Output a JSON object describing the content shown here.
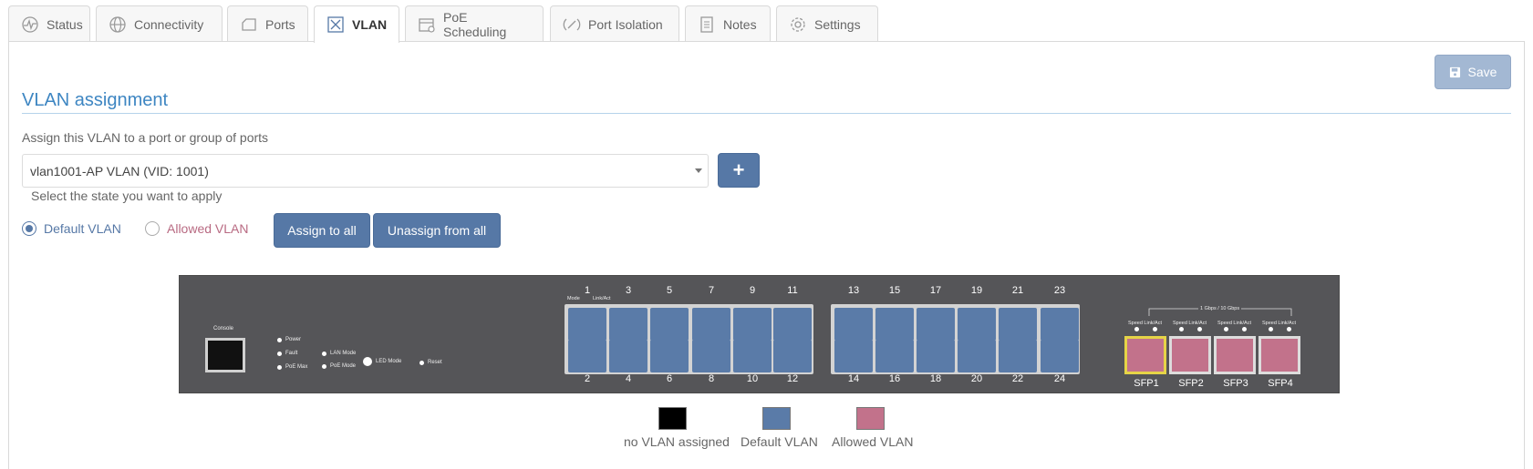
{
  "tabs": [
    {
      "label": "Status",
      "icon": "pulse-icon"
    },
    {
      "label": "Connectivity",
      "icon": "globe-icon"
    },
    {
      "label": "Ports",
      "icon": "ports-icon"
    },
    {
      "label": "VLAN",
      "icon": "vlan-icon",
      "active": true
    },
    {
      "label": "PoE Scheduling",
      "icon": "calendar-icon"
    },
    {
      "label": "Port Isolation",
      "icon": "isolation-icon"
    },
    {
      "label": "Notes",
      "icon": "notes-icon"
    },
    {
      "label": "Settings",
      "icon": "gear-icon"
    }
  ],
  "toolbar": {
    "save_label": "Save"
  },
  "section": {
    "title": "VLAN assignment",
    "assign_label": "Assign this VLAN to a port or group of ports",
    "selected_vlan": "vlan1001-AP VLAN (VID: 1001)",
    "add_label": "+",
    "state_label": "Select the state you want to apply",
    "radio_default": "Default VLAN",
    "radio_allowed": "Allowed VLAN",
    "assign_all": "Assign to all",
    "unassign_all": "Unassign from all"
  },
  "switch": {
    "console": "Console",
    "leds": {
      "power": "Power",
      "fault": "Fault",
      "poe_max": "PoE Max",
      "lan_mode": "LAN Mode",
      "poe_mode": "PoE Mode",
      "led_mode": "LED Mode",
      "reset": "Reset"
    },
    "mode_label": "Mode",
    "link_act_label": "Link/Act",
    "sfp_header": "1 Gbps / 10 Gbps",
    "sfp_speed_label": "Speed Link/Act",
    "top_ports": [
      "1",
      "3",
      "5",
      "7",
      "9",
      "11",
      "13",
      "15",
      "17",
      "19",
      "21",
      "23"
    ],
    "bottom_ports": [
      "2",
      "4",
      "6",
      "8",
      "10",
      "12",
      "14",
      "16",
      "18",
      "20",
      "22",
      "24"
    ],
    "sfp_ports": [
      "SFP1",
      "SFP2",
      "SFP3",
      "SFP4"
    ]
  },
  "legend": [
    {
      "label": "no VLAN assigned",
      "color": "#000000"
    },
    {
      "label": "Default VLAN",
      "color": "#5a7ba8"
    },
    {
      "label": "Allowed VLAN",
      "color": "#c2728b"
    }
  ],
  "colors": {
    "accent": "#3e86c2",
    "button": "#5678a6",
    "default_vlan": "#5a7ba8",
    "allowed_vlan": "#c2728b",
    "allowed_text": "#b86a82"
  }
}
